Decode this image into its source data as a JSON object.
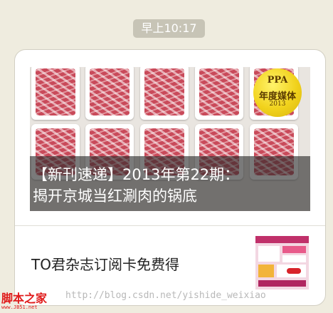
{
  "timestamp": "早上10:17",
  "card": {
    "cover_caption_line1": "【新刊速递】2013年第22期：",
    "cover_caption_line2": "揭开京城当红涮肉的锅底",
    "badge_line1": "PPA",
    "badge_line2": "年度媒体",
    "badge_line3": "2013",
    "article_title": "TO君杂志订阅卡免费得"
  },
  "watermark": {
    "logo": "脚本之家",
    "sub": "www.JB51.net",
    "url": "http://blog.csdn.net/yishide_weixiao"
  },
  "colors": {
    "background": "#efecdf",
    "timestamp_bg": "#c7c4b6",
    "watermark_red": "#e01b1b"
  }
}
